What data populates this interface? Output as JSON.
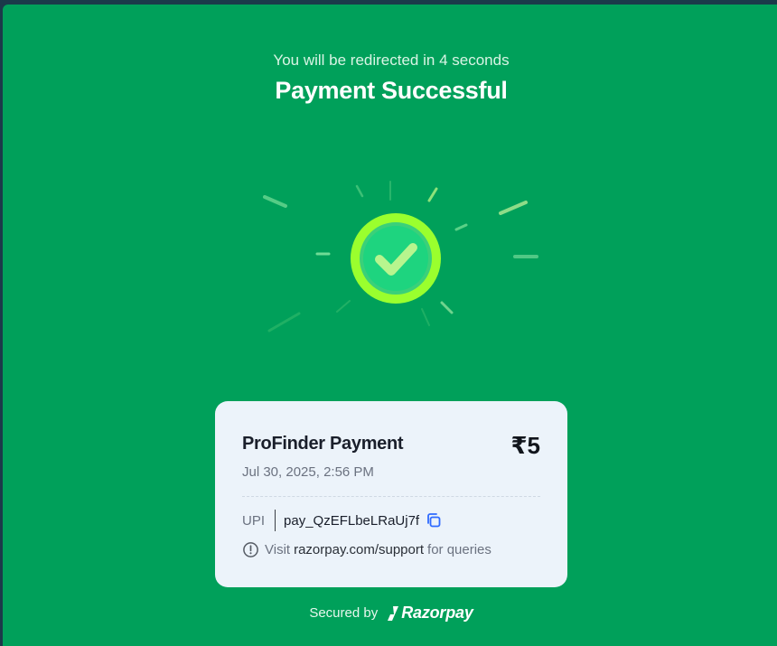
{
  "header": {
    "redirect_text": "You will be redirected in 4 seconds",
    "title": "Payment Successful"
  },
  "status_icon": {
    "icon": "check-icon",
    "ring_color": "#9aff2e",
    "inner_color": "#1ed47f",
    "check_color": "#b7f58e"
  },
  "card": {
    "merchant": "ProFinder Payment",
    "amount": "₹5",
    "datetime": "Jul 30, 2025, 2:56 PM",
    "payment_method": "UPI",
    "payment_id": "pay_QzEFLbeLRaUj7f",
    "copy_icon": "copy-icon",
    "support_prefix": "Visit",
    "support_link": "razorpay.com/support",
    "support_suffix": "for queries"
  },
  "footer": {
    "secured_by": "Secured by",
    "brand": "Razorpay"
  },
  "colors": {
    "background": "#00a05a",
    "card": "#ecf3fa",
    "copy_icon": "#2f6bff"
  }
}
